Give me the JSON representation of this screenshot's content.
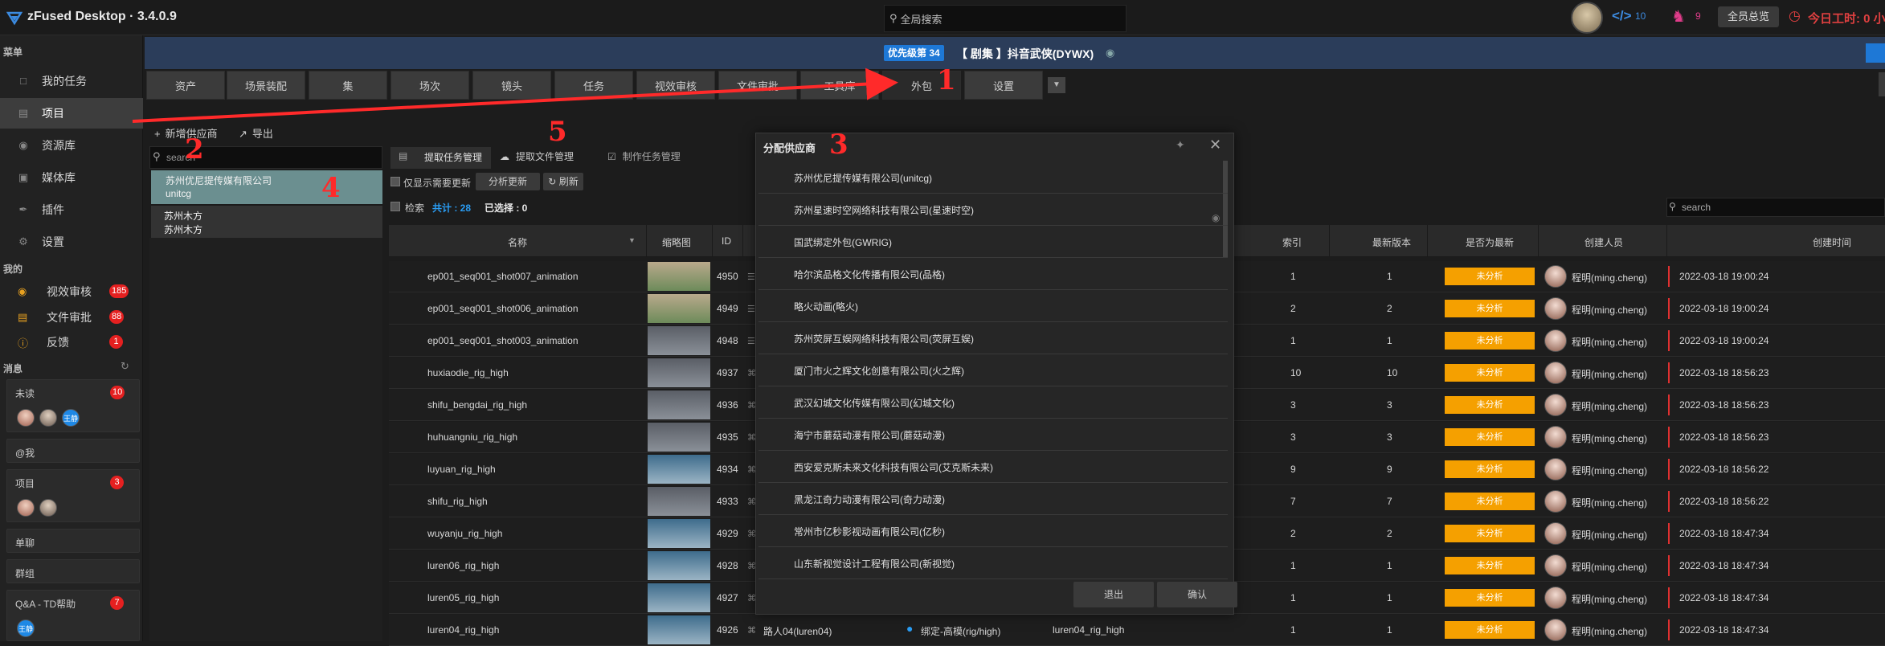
{
  "app": {
    "title": "zFused Desktop · 3.4.0.9",
    "search_placeholder": "全局搜索"
  },
  "header": {
    "code_count": "10",
    "game_count": "9",
    "overview": "全员总览",
    "worktime": "今日工时: 0 小"
  },
  "sidebar": {
    "menu_label": "菜单",
    "items": [
      {
        "label": "我的任务",
        "icon": "checkbox-icon"
      },
      {
        "label": "项目",
        "icon": "folder-icon"
      },
      {
        "label": "资源库",
        "icon": "resource-icon"
      },
      {
        "label": "媒体库",
        "icon": "media-icon"
      },
      {
        "label": "插件",
        "icon": "plugin-icon"
      },
      {
        "label": "设置",
        "icon": "gear-icon"
      }
    ],
    "mine_label": "我的",
    "mine": [
      {
        "label": "视效审核",
        "count": "185"
      },
      {
        "label": "文件审批",
        "count": "88"
      },
      {
        "label": "反馈",
        "count": "1"
      }
    ],
    "messages_label": "消息",
    "messages": [
      {
        "label": "未读",
        "count": "10"
      },
      {
        "label": "@我"
      },
      {
        "label": "项目",
        "count": "3"
      },
      {
        "label": "单聊"
      },
      {
        "label": "群组"
      },
      {
        "label": "Q&A - TD帮助",
        "count": "7"
      }
    ],
    "avatar_text": "王静"
  },
  "project": {
    "priority": "优先级第 34",
    "name": "【 剧集 】抖音武侠(DYWX)"
  },
  "tabs": [
    "资产",
    "场景装配",
    "集",
    "场次",
    "镜头",
    "任务",
    "视效审核",
    "文件审批",
    "工具库",
    "外包",
    "设置"
  ],
  "toolbar": {
    "add": "新增供应商",
    "export": "导出"
  },
  "suppliers": {
    "search": "search",
    "items": [
      {
        "name": "苏州优尼提传媒有限公司",
        "code": "unitcg"
      },
      {
        "name": "苏州木方",
        "code": "苏州木方"
      }
    ]
  },
  "panel": {
    "tabs": [
      "提取任务管理",
      "提取文件管理",
      "制作任务管理"
    ],
    "only_changed": "仅显示需要更新",
    "analyze": "分析更新",
    "refresh": "刷新",
    "search_label": "检索",
    "total": "共计 : 28",
    "selected": "已选择 : 0",
    "right_search": "search"
  },
  "table": {
    "headers": [
      "名称",
      "缩略图",
      "ID",
      "索引",
      "最新版本",
      "是否为最新",
      "创建人员",
      "创建时间"
    ],
    "rows": [
      {
        "name": "ep001_seq001_shot007_animation",
        "id": "4950",
        "index": "1",
        "version": "1",
        "status": "未分析",
        "creator": "程明(ming.cheng)",
        "time": "2022-03-18 19:00:24",
        "thumb": "anim"
      },
      {
        "name": "ep001_seq001_shot006_animation",
        "id": "4949",
        "index": "2",
        "version": "2",
        "status": "未分析",
        "creator": "程明(ming.cheng)",
        "time": "2022-03-18 19:00:24",
        "thumb": "anim"
      },
      {
        "name": "ep001_seq001_shot003_animation",
        "id": "4948",
        "index": "1",
        "version": "1",
        "status": "未分析",
        "creator": "程明(ming.cheng)",
        "time": "2022-03-18 19:00:24",
        "thumb": "gray"
      },
      {
        "name": "huxiaodie_rig_high",
        "id": "4937",
        "index": "10",
        "version": "10",
        "status": "未分析",
        "creator": "程明(ming.cheng)",
        "time": "2022-03-18 18:56:23",
        "thumb": "gray"
      },
      {
        "name": "shifu_bengdai_rig_high",
        "id": "4936",
        "index": "3",
        "version": "3",
        "status": "未分析",
        "creator": "程明(ming.cheng)",
        "time": "2022-03-18 18:56:23",
        "thumb": "gray"
      },
      {
        "name": "huhuangniu_rig_high",
        "id": "4935",
        "index": "3",
        "version": "3",
        "status": "未分析",
        "creator": "程明(ming.cheng)",
        "time": "2022-03-18 18:56:23",
        "thumb": "gray"
      },
      {
        "name": "luyuan_rig_high",
        "id": "4934",
        "index": "9",
        "version": "9",
        "status": "未分析",
        "creator": "程明(ming.cheng)",
        "time": "2022-03-18 18:56:22",
        "thumb": "rig"
      },
      {
        "name": "shifu_rig_high",
        "id": "4933",
        "index": "7",
        "version": "7",
        "status": "未分析",
        "creator": "程明(ming.cheng)",
        "time": "2022-03-18 18:56:22",
        "thumb": "gray"
      },
      {
        "name": "wuyanju_rig_high",
        "id": "4929",
        "index": "2",
        "version": "2",
        "status": "未分析",
        "creator": "程明(ming.cheng)",
        "time": "2022-03-18 18:47:34",
        "thumb": "rig"
      },
      {
        "name": "luren06_rig_high",
        "id": "4928",
        "index": "1",
        "version": "1",
        "status": "未分析",
        "creator": "程明(ming.cheng)",
        "time": "2022-03-18 18:47:34",
        "thumb": "rig"
      },
      {
        "name": "luren05_rig_high",
        "id": "4927",
        "index": "1",
        "version": "1",
        "status": "未分析",
        "creator": "程明(ming.cheng)",
        "time": "2022-03-18 18:47:34",
        "thumb": "rig"
      },
      {
        "name": "luren04_rig_high",
        "id": "4926",
        "index": "1",
        "version": "1",
        "status": "未分析",
        "creator": "程明(ming.cheng)",
        "time": "2022-03-18 18:47:34",
        "thumb": "rig",
        "extra1": "路人04(luren04)",
        "extra2": "绑定-高模(rig/high)",
        "extra3": "luren04_rig_high"
      }
    ]
  },
  "dialog": {
    "title": "分配供应商",
    "items": [
      "苏州优尼提传媒有限公司(unitcg)",
      "苏州星速时空网络科技有限公司(星速时空)",
      "国武绑定外包(GWRIG)",
      "哈尔滨品格文化传播有限公司(品格)",
      "略火动画(略火)",
      "苏州荧屏互娱网络科技有限公司(荧屏互娱)",
      "厦门市火之辉文化创意有限公司(火之辉)",
      "武汉幻城文化传媒有限公司(幻城文化)",
      "海宁市蘑菇动漫有限公司(蘑菇动漫)",
      "西安爱克斯未来文化科技有限公司(艾克斯未来)",
      "黑龙江奇力动漫有限公司(奇力动漫)",
      "常州市亿秒影视动画有限公司(亿秒)",
      "山东新视觉设计工程有限公司(新视觉)"
    ],
    "cancel": "退出",
    "confirm": "确认"
  },
  "annotations": [
    "1",
    "2",
    "3",
    "4",
    "5"
  ],
  "colors": {
    "accent": "#1e78d6",
    "status": "#f5a000",
    "badge": "#e52020",
    "annotation": "#ff2a2a"
  }
}
